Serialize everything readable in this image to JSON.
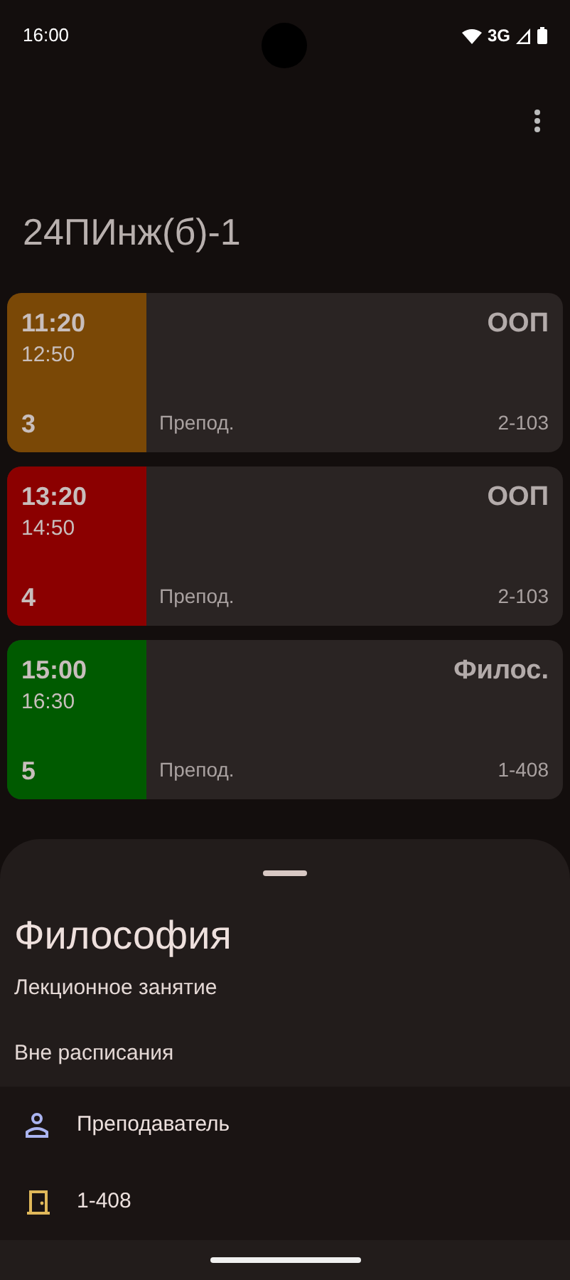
{
  "status_bar": {
    "time": "16:00",
    "network": "3G"
  },
  "title": "24ПИнж(б)-1",
  "lessons": [
    {
      "start": "11:20",
      "end": "12:50",
      "number": "3",
      "subject": "ООП",
      "teacher": "Препод.",
      "room": "2-103",
      "color": "#7a4806"
    },
    {
      "start": "13:20",
      "end": "14:50",
      "number": "4",
      "subject": "ООП",
      "teacher": "Препод.",
      "room": "2-103",
      "color": "#8b0000"
    },
    {
      "start": "15:00",
      "end": "16:30",
      "number": "5",
      "subject": "Филос.",
      "teacher": "Препод.",
      "room": "1-408",
      "color": "#005a00"
    }
  ],
  "sheet": {
    "title": "Философия",
    "type": "Лекционное занятие",
    "note": "Вне расписания",
    "details": [
      {
        "kind": "teacher",
        "text": "Преподаватель"
      },
      {
        "kind": "room",
        "text": "1-408"
      }
    ]
  }
}
